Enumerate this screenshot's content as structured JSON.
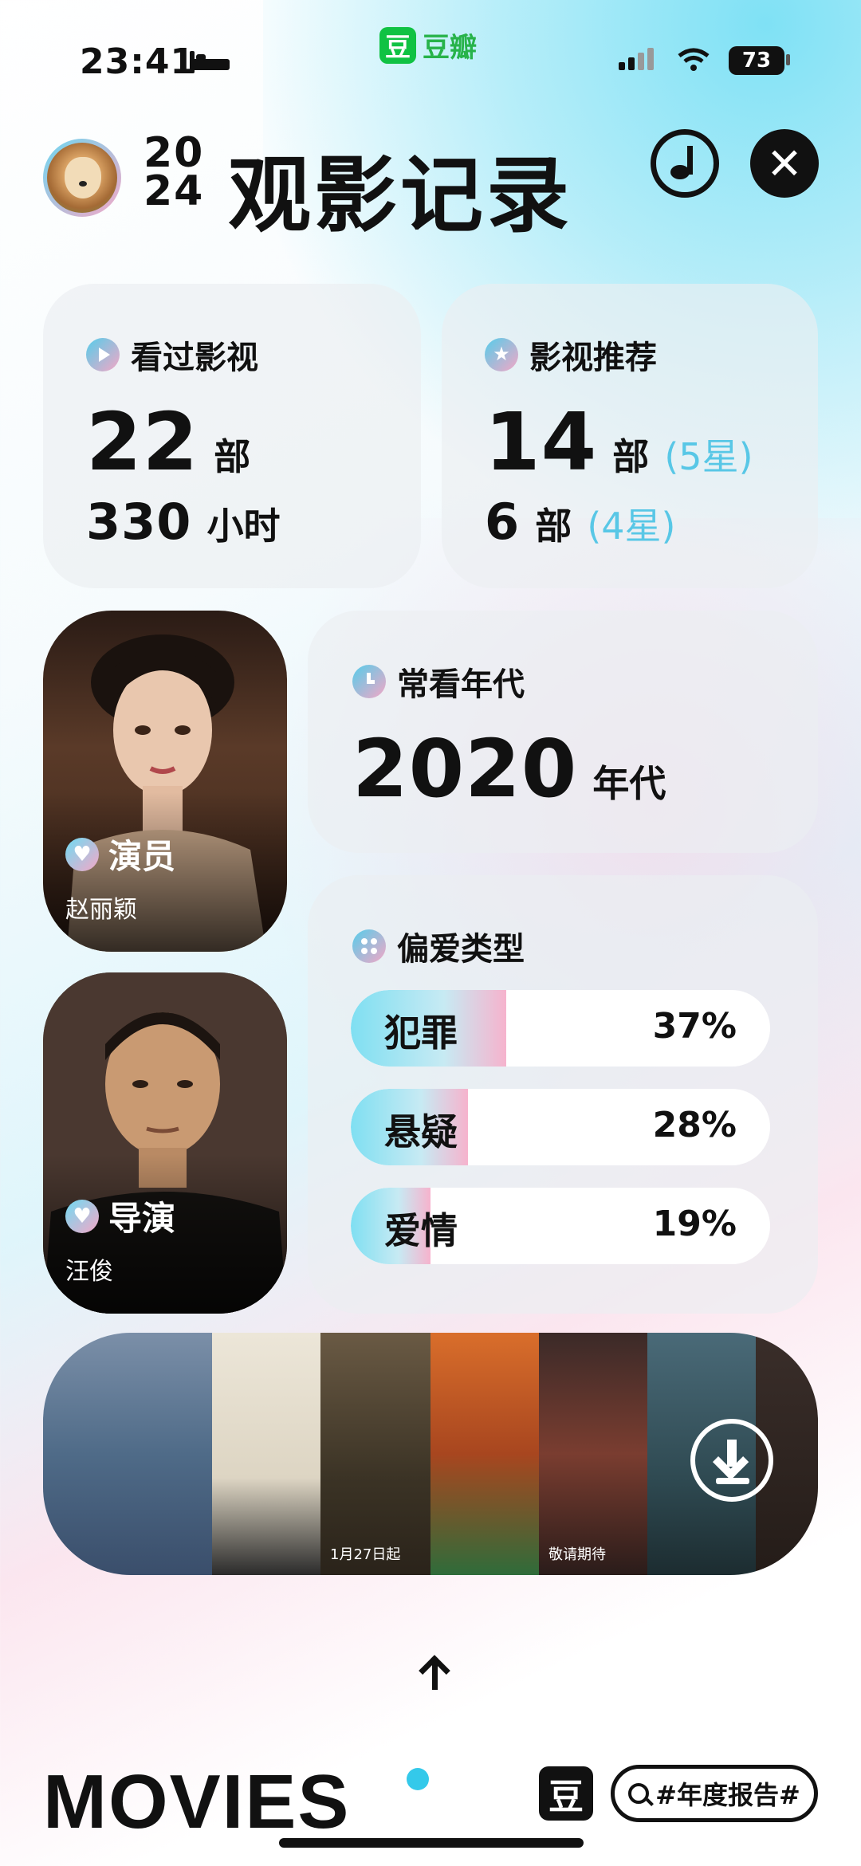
{
  "status_bar": {
    "time": "23:41",
    "app_badge_icon": "豆",
    "app_name": "豆瓣",
    "battery": "73"
  },
  "header": {
    "year_top": "20",
    "year_bottom": "24",
    "title": "观影记录"
  },
  "watched": {
    "title": "看过影视",
    "count": "22",
    "count_unit": "部",
    "hours": "330",
    "hours_unit": "小时"
  },
  "recommend": {
    "title": "影视推荐",
    "five_star_count": "14",
    "five_star_unit": "部",
    "five_star_label": "(5星)",
    "four_star_count": "6",
    "four_star_unit": "部",
    "four_star_label": "(4星)"
  },
  "actor": {
    "role": "演员",
    "name": "赵丽颖"
  },
  "director": {
    "role": "导演",
    "name": "汪俊"
  },
  "era": {
    "title": "常看年代",
    "value": "2020",
    "unit": "年代"
  },
  "genres": {
    "title": "偏爱类型",
    "items": [
      {
        "label": "犯罪",
        "pct_text": "37%",
        "pct": 0.37
      },
      {
        "label": "悬疑",
        "pct_text": "28%",
        "pct": 0.28
      },
      {
        "label": "爱情",
        "pct_text": "19%",
        "pct": 0.19
      }
    ]
  },
  "posters": {
    "captions": [
      "",
      "",
      "1月27日起",
      "",
      "敬请期待",
      "",
      ""
    ]
  },
  "footer": {
    "brand": "MOVIES",
    "dou_label": "豆",
    "tag_label": "#年度报告#"
  }
}
